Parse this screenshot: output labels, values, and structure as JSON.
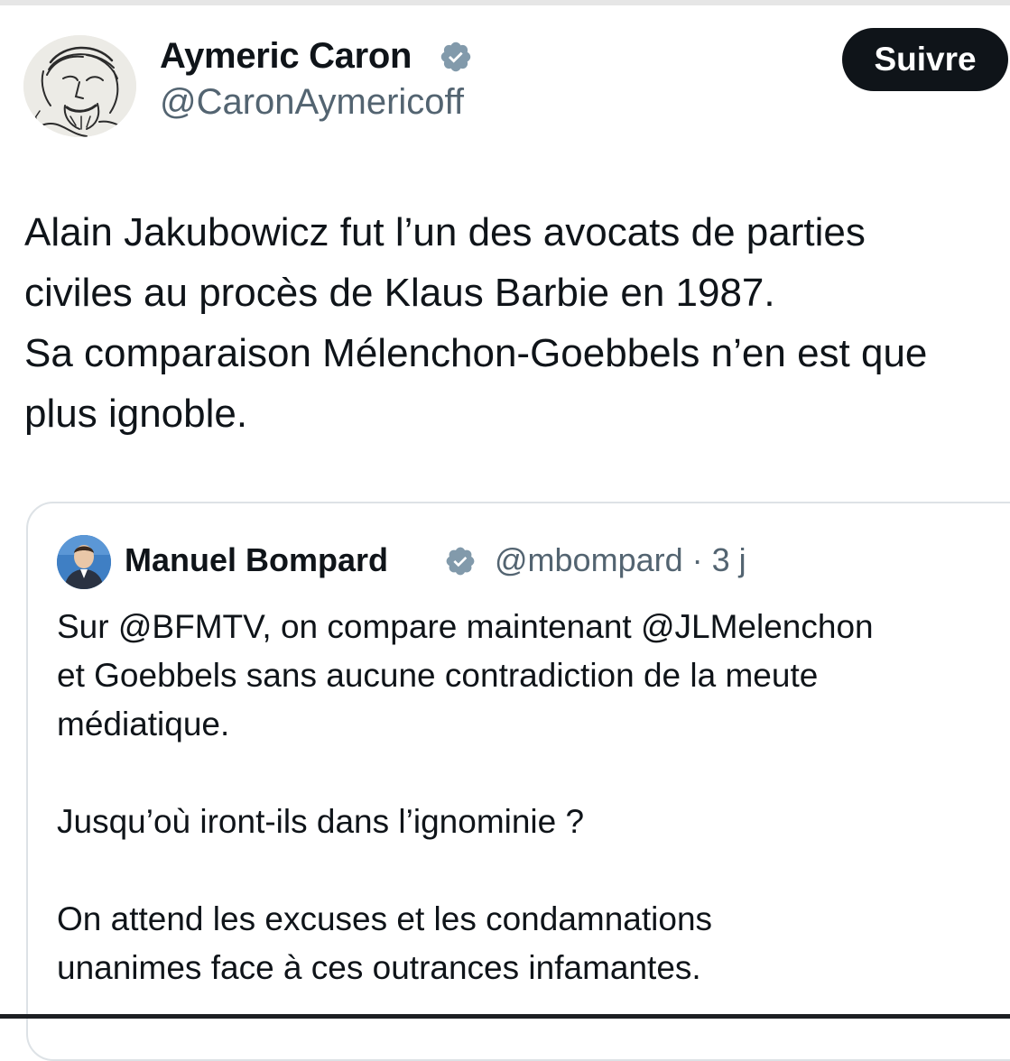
{
  "author": {
    "name": "Aymeric Caron",
    "handle": "@CaronAymericoff",
    "verified_icon": "verified-badge-icon",
    "follow_label": "Suivre"
  },
  "tweet": {
    "lines": [
      "Alain Jakubowicz fut l’un des avocats de parties",
      "civiles au procès de Klaus Barbie en 1987.",
      "Sa comparaison Mélenchon-Goebbels n’en est que",
      "plus ignoble."
    ]
  },
  "quote": {
    "name": "Manuel Bompard",
    "handle": "@mbompard",
    "separator": "·",
    "age": "3 j",
    "paragraphs": [
      "Sur @BFMTV, on compare maintenant @JLMelenchon\net Goebbels sans aucune contradiction de la meute\nmédiatique.",
      "Jusqu’où iront-ils dans l’ignominie ?",
      "On attend les excuses et les condamnations\nunanimes face à ces outrances infamantes."
    ]
  },
  "colors": {
    "text": "#0f1419",
    "secondary": "#536471",
    "border": "#dde2e6",
    "verified_badge": "#829aab"
  }
}
